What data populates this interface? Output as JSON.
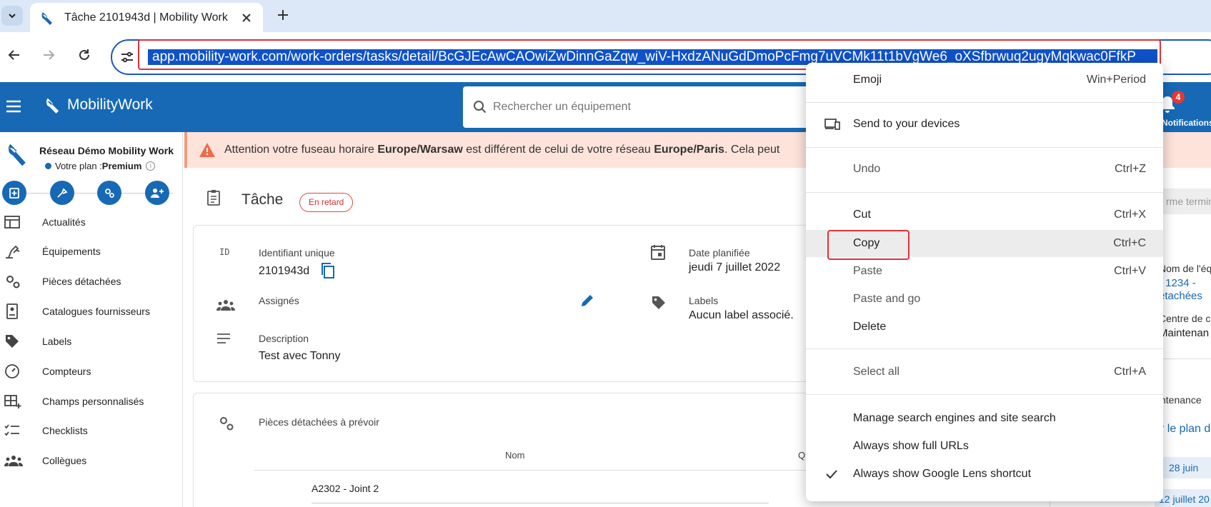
{
  "browser": {
    "tab_title": "Tâche 2101943d | Mobility Work",
    "url": "app.mobility-work.com/work-orders/tasks/detail/BcGJEcAwCAOwiZwDinnGaZqw_wiV-HxdzANuGdDmoPcFmg7uVCMk11t1bVgWe6_oXSfbrwuq2ugyMqkwac0FfkP"
  },
  "app": {
    "brand": "MobilityWork",
    "search_placeholder": "Rechercher un équipement",
    "notifications_count": "4",
    "notifications_label": "Notifications",
    "org_name": "Réseau Démo Mobility Work",
    "plan_prefix": "Votre plan : ",
    "plan_name": "Premium"
  },
  "sidebar": {
    "items": [
      {
        "label": "Actualités",
        "icon": "news-icon"
      },
      {
        "label": "Équipements",
        "icon": "equipment-icon"
      },
      {
        "label": "Pièces détachées",
        "icon": "spare-parts-icon"
      },
      {
        "label": "Catalogues fournisseurs",
        "icon": "catalog-icon"
      },
      {
        "label": "Labels",
        "icon": "label-icon"
      },
      {
        "label": "Compteurs",
        "icon": "counter-icon"
      },
      {
        "label": "Champs personnalisés",
        "icon": "custom-fields-icon"
      },
      {
        "label": "Checklists",
        "icon": "checklist-icon"
      },
      {
        "label": "Collègues",
        "icon": "colleagues-icon"
      }
    ]
  },
  "banner": {
    "prefix": "Attention votre fuseau horaire ",
    "tz_user": "Europe/Warsaw",
    "middle": " est différent de celui de votre réseau ",
    "tz_network": "Europe/Paris",
    "suffix": ". Cela peut"
  },
  "task": {
    "title": "Tâche",
    "status": "En retard",
    "id_icon_text": "ID",
    "id_label": "Identifiant unique",
    "id_value": "2101943d",
    "date_label": "Date planifiée",
    "date_value": "jeudi 7 juillet 2022",
    "assignees_label": "Assignés",
    "labels_label": "Labels",
    "labels_value": "Aucun label associé.",
    "description_label": "Description",
    "description_value": "Test avec Tonny",
    "parts_title": "Pièces détachées à prévoir",
    "parts_col_name": "Nom",
    "parts_col_qty": "Q",
    "parts_rows": [
      "A2302 - Joint 2"
    ]
  },
  "right_panel": {
    "button_partial": "rme termin",
    "equip_label": "Nom de l'éq",
    "equip_value1": "- 1234 -",
    "equip_value2": "étachées",
    "center_label": "Centre de c",
    "center_value": "Maintenan",
    "maint_label": "ntenance",
    "plan_link": "r le plan d",
    "date_prev": "28 juin",
    "date_next": "12 juillet 20"
  },
  "context_menu": {
    "items": [
      {
        "label": "Emoji",
        "shortcut": "Win+Period"
      },
      {
        "label": "Send to your devices",
        "shortcut": ""
      },
      {
        "label": "Undo",
        "shortcut": "Ctrl+Z"
      },
      {
        "label": "Cut",
        "shortcut": "Ctrl+X"
      },
      {
        "label": "Copy",
        "shortcut": "Ctrl+C"
      },
      {
        "label": "Paste",
        "shortcut": "Ctrl+V"
      },
      {
        "label": "Paste and go",
        "shortcut": ""
      },
      {
        "label": "Delete",
        "shortcut": ""
      },
      {
        "label": "Select all",
        "shortcut": "Ctrl+A"
      },
      {
        "label": "Manage search engines and site search",
        "shortcut": ""
      },
      {
        "label": "Always show full URLs",
        "shortcut": ""
      },
      {
        "label": "Always show Google Lens shortcut",
        "shortcut": ""
      }
    ]
  },
  "colors": {
    "brand_blue": "#1769b5",
    "url_selection": "#0f52c9",
    "highlight_red": "#e0313a",
    "banner_bg": "#fde3da"
  }
}
